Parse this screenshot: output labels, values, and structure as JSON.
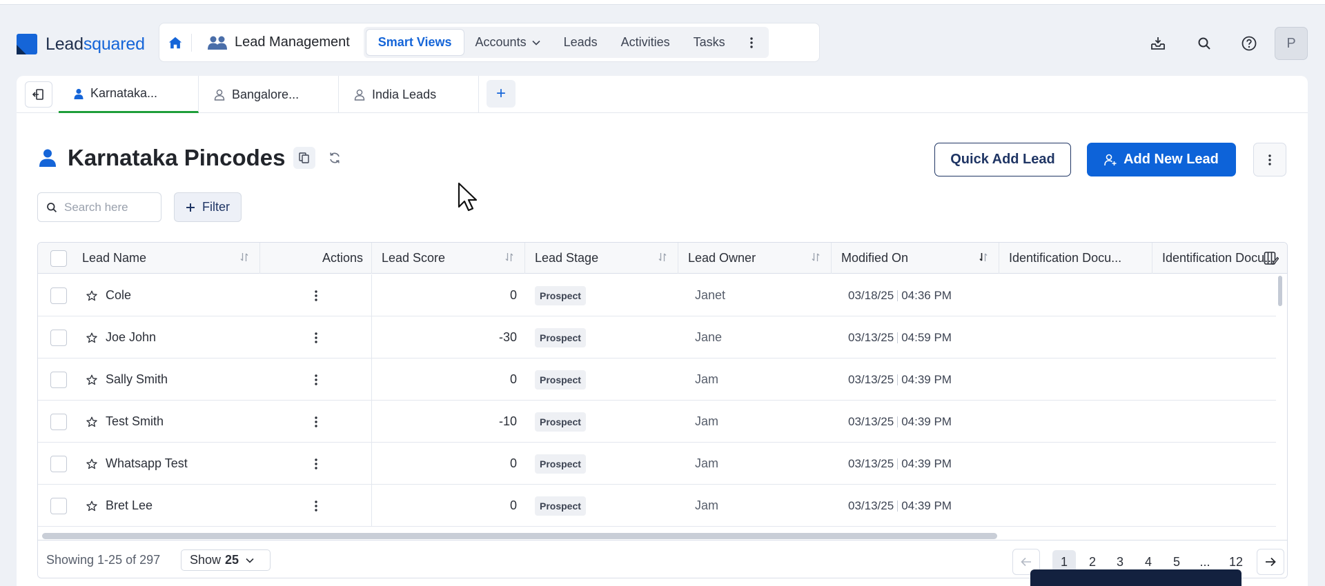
{
  "brand": {
    "logo_part1": "Lead",
    "logo_part2": "squared"
  },
  "navbar": {
    "module_label": "Lead Management",
    "tabs": [
      {
        "label": "Smart Views",
        "active": true
      },
      {
        "label": "Accounts",
        "has_dropdown": true
      },
      {
        "label": "Leads"
      },
      {
        "label": "Activities"
      },
      {
        "label": "Tasks"
      }
    ]
  },
  "topbar": {
    "icons": [
      "download-tray-icon",
      "search-icon",
      "help-icon"
    ],
    "avatar_initial": "P"
  },
  "smart_view_tabs": [
    {
      "label": "Karnataka...",
      "active": true
    },
    {
      "label": "Bangalore..."
    },
    {
      "label": "India Leads"
    }
  ],
  "page": {
    "title": "Karnataka Pincodes",
    "quick_add_label": "Quick Add Lead",
    "add_new_label": "Add New Lead"
  },
  "search": {
    "placeholder": "Search here",
    "value": ""
  },
  "filter_label": "Filter",
  "grid": {
    "columns": [
      "Lead Name",
      "Actions",
      "Lead Score",
      "Lead Stage",
      "Lead Owner",
      "Modified On",
      "Identification Docu...",
      "Identification Docu..."
    ],
    "rows": [
      {
        "name": "Cole",
        "score": "0",
        "stage": "Prospect",
        "owner": "Janet",
        "date": "03/18/25",
        "time": "04:36 PM"
      },
      {
        "name": "Joe John",
        "score": "-30",
        "stage": "Prospect",
        "owner": "Jane",
        "date": "03/13/25",
        "time": "04:59 PM"
      },
      {
        "name": "Sally Smith",
        "score": "0",
        "stage": "Prospect",
        "owner": "Jam",
        "date": "03/13/25",
        "time": "04:39 PM"
      },
      {
        "name": "Test Smith",
        "score": "-10",
        "stage": "Prospect",
        "owner": "Jam",
        "date": "03/13/25",
        "time": "04:39 PM"
      },
      {
        "name": "Whatsapp Test",
        "score": "0",
        "stage": "Prospect",
        "owner": "Jam",
        "date": "03/13/25",
        "time": "04:39 PM"
      },
      {
        "name": "Bret Lee",
        "score": "0",
        "stage": "Prospect",
        "owner": "Jam",
        "date": "03/13/25",
        "time": "04:39 PM"
      }
    ]
  },
  "footer": {
    "showing": "Showing 1-25 of 297",
    "show_prefix": "Show",
    "show_value": "25",
    "pages": [
      "1",
      "2",
      "3",
      "4",
      "5",
      "...",
      "12"
    ],
    "current_page": "1"
  },
  "colors": {
    "accent": "#1565d8",
    "primary_button": "#0d63d9",
    "active_tab_underline": "#1e9e3a",
    "toast": "#13213f"
  }
}
